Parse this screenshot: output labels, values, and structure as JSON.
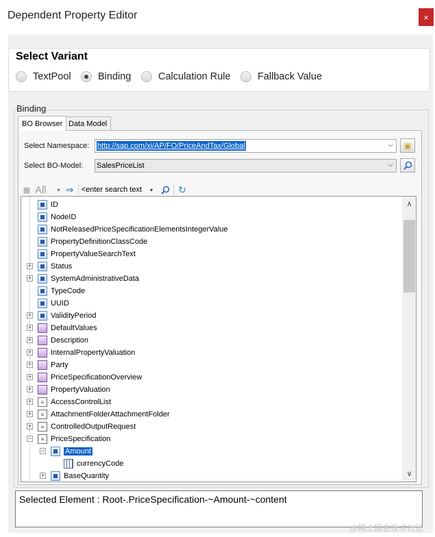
{
  "window": {
    "title": "Dependent Property Editor",
    "close_label": "×"
  },
  "variant": {
    "title": "Select Variant",
    "options": [
      {
        "label": "TextPool",
        "selected": false
      },
      {
        "label": "Binding",
        "selected": true
      },
      {
        "label": "Calculation Rule",
        "selected": false
      },
      {
        "label": "Fallback Value",
        "selected": false
      }
    ]
  },
  "binding": {
    "title": "Binding",
    "tabs": [
      {
        "label": "BO Browser",
        "active": true
      },
      {
        "label": "Data Model",
        "active": false
      }
    ],
    "namespace": {
      "label": "Select Namespace:",
      "value": "http://sap.com/xi/AP/FO/PriceAndTax/Global"
    },
    "bo_model": {
      "label": "Select BO-Model:",
      "value": "SalesPriceList"
    },
    "toolbar": {
      "filter_label": "All",
      "search_placeholder": "<enter search text"
    },
    "tree": [
      {
        "label": "ID",
        "icon": "element",
        "depth": 1,
        "expander": false
      },
      {
        "label": "NodeID",
        "icon": "element",
        "depth": 1,
        "expander": false
      },
      {
        "label": "NotReleasedPriceSpecificationElementsIntegerValue",
        "icon": "element",
        "depth": 1,
        "expander": false
      },
      {
        "label": "PropertyDefinitionClassCode",
        "icon": "element",
        "depth": 1,
        "expander": false
      },
      {
        "label": "PropertyValueSearchText",
        "icon": "element",
        "depth": 1,
        "expander": false
      },
      {
        "label": "Status",
        "icon": "element",
        "depth": 1,
        "expander": "+"
      },
      {
        "label": "SystemAdministrativeData",
        "icon": "element",
        "depth": 1,
        "expander": "+"
      },
      {
        "label": "TypeCode",
        "icon": "element",
        "depth": 1,
        "expander": false
      },
      {
        "label": "UUID",
        "icon": "element",
        "depth": 1,
        "expander": false
      },
      {
        "label": "ValidityPeriod",
        "icon": "element",
        "depth": 1,
        "expander": "+"
      },
      {
        "label": "DefaultValues",
        "icon": "association",
        "depth": 1,
        "expander": "+"
      },
      {
        "label": "Description",
        "icon": "association",
        "depth": 1,
        "expander": "+"
      },
      {
        "label": "InternalPropertyValuation",
        "icon": "association",
        "depth": 1,
        "expander": "+"
      },
      {
        "label": "Party",
        "icon": "association",
        "depth": 1,
        "expander": "+"
      },
      {
        "label": "PriceSpecificationOverview",
        "icon": "association",
        "depth": 1,
        "expander": "+"
      },
      {
        "label": "PropertyValuation",
        "icon": "association",
        "depth": 1,
        "expander": "+"
      },
      {
        "label": "AccessControlList",
        "icon": "node",
        "depth": 1,
        "expander": "+"
      },
      {
        "label": "AttachmentFolderAttachmentFolder",
        "icon": "node",
        "depth": 1,
        "expander": "+"
      },
      {
        "label": "ControlledOutputRequest",
        "icon": "node",
        "depth": 1,
        "expander": "+"
      },
      {
        "label": "PriceSpecification",
        "icon": "node",
        "depth": 1,
        "expander": "−"
      },
      {
        "label": "Amount",
        "icon": "element",
        "depth": 2,
        "expander": "−",
        "selected": true
      },
      {
        "label": "currencyCode",
        "icon": "attribute",
        "depth": 3,
        "expander": false
      },
      {
        "label": "BaseQuantity",
        "icon": "element",
        "depth": 2,
        "expander": "+"
      }
    ]
  },
  "status": {
    "text": "Selected Element : Root-.PriceSpecification-~Amount-~content"
  },
  "watermark": "@稀土掘金技术社区",
  "colors": {
    "selection": "#0a64c8",
    "close_button": "#c62828"
  }
}
